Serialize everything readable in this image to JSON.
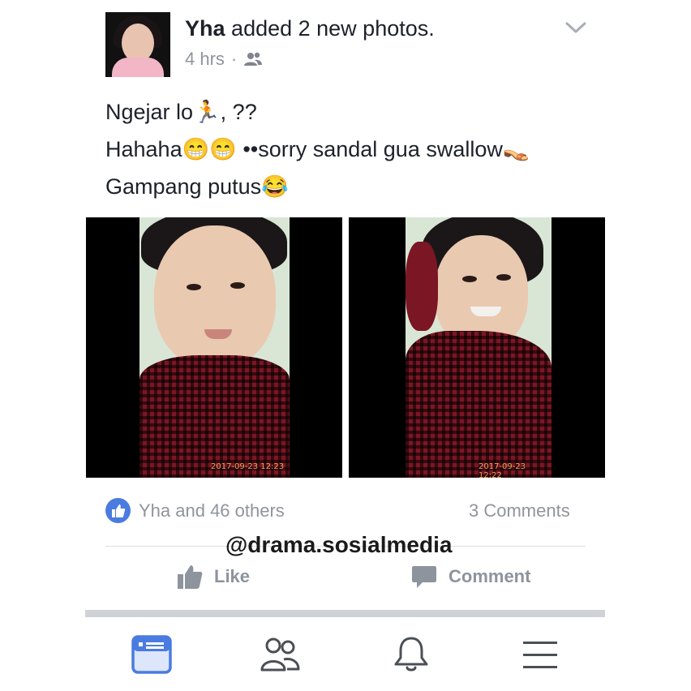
{
  "post": {
    "author": "Yha",
    "action_text": "added 2 new photos.",
    "time": "4 hrs",
    "separator": "·",
    "audience_icon": "friends-icon",
    "text_lines": [
      "Ngejar lo🏃, ??",
      "Hahaha😁😁 ••sorry sandal gua swallow👡",
      "Gampang putus😂"
    ],
    "photos": [
      {
        "timestamp": "2017-09-23 12:23"
      },
      {
        "timestamp": "2017-09-23 12:22"
      }
    ]
  },
  "reactions": {
    "likes_text": "Yha and 46 others",
    "comments_text": "3 Comments"
  },
  "watermark": "@drama.sosialmedia",
  "actions": {
    "like_label": "Like",
    "comment_label": "Comment"
  },
  "bottom_nav": {
    "items": [
      "news-feed-icon",
      "friends-icon",
      "notifications-bell-icon",
      "menu-icon"
    ],
    "active": "news-feed-icon"
  },
  "colors": {
    "accent": "#4a7be0",
    "muted": "#90949c",
    "nav_active": "#4a7be0",
    "nav_inactive": "#4b4f56"
  }
}
